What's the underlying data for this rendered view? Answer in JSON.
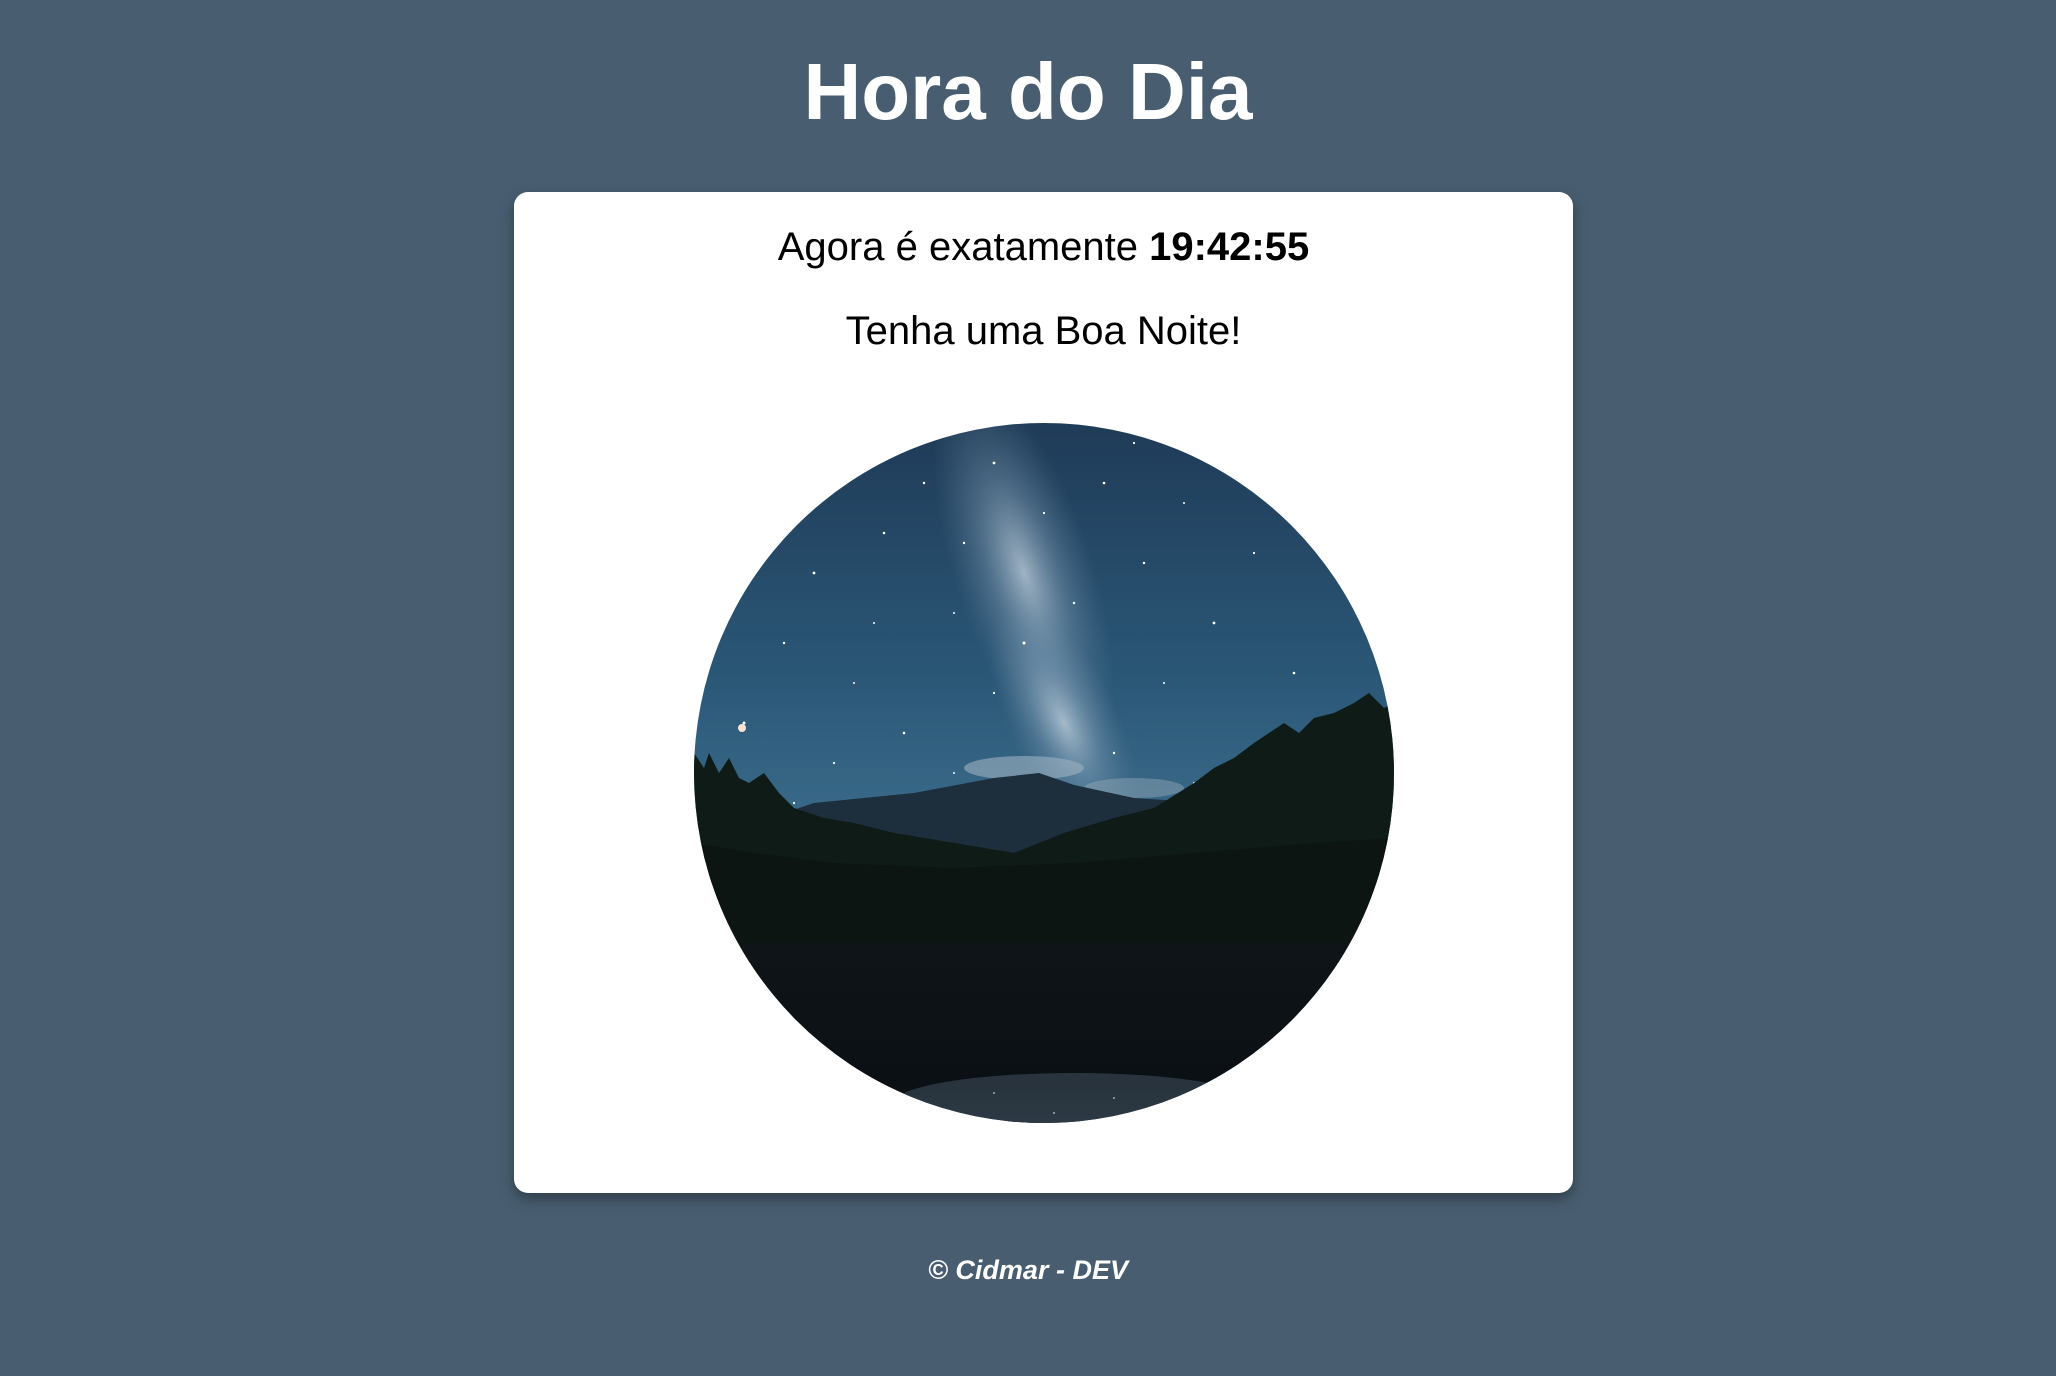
{
  "header": {
    "title": "Hora do Dia"
  },
  "clock": {
    "prefix": "Agora é exatamente ",
    "time": "19:42:55",
    "greeting": "Tenha uma Boa Noite!"
  },
  "image": {
    "subject": "night-sky-milky-way-lake-forest"
  },
  "footer": {
    "text": "© Cidmar - DEV"
  },
  "colors": {
    "background": "#485e70",
    "card": "#ffffff",
    "title": "#ffffff"
  }
}
